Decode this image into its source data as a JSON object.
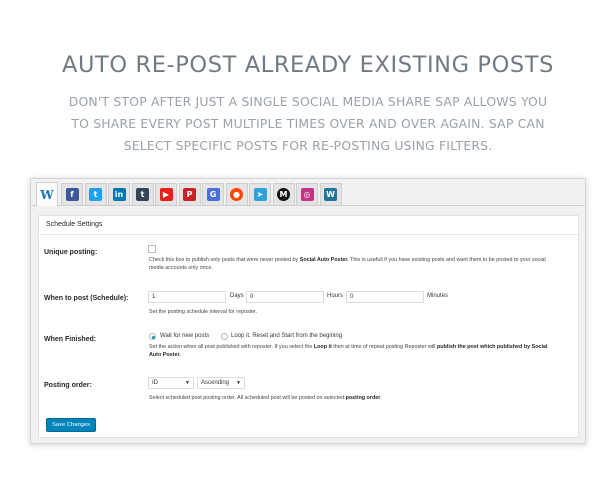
{
  "hero": {
    "title": "AUTO RE-POST ALREADY EXISTING POSTS",
    "line1": "DON'T STOP AFTER JUST A SINGLE SOCIAL MEDIA SHARE SAP ALLOWS YOU",
    "line2": "TO SHARE EVERY POST MULTIPLE TIMES OVER AND OVER AGAIN. SAP CAN",
    "line3": "SELECT SPECIFIC POSTS FOR RE-POSTING USING FILTERS."
  },
  "tabs": {
    "active_logo": "W",
    "items": [
      {
        "icon": "general-w-icon",
        "glyph": "W",
        "color": "#1a74b0"
      },
      {
        "icon": "facebook-icon",
        "glyph": "f",
        "color": "#3b5998"
      },
      {
        "icon": "twitter-icon",
        "glyph": "t",
        "color": "#1da1f2"
      },
      {
        "icon": "linkedin-icon",
        "glyph": "in",
        "color": "#0077b5"
      },
      {
        "icon": "tumblr-icon",
        "glyph": "t",
        "color": "#35465c"
      },
      {
        "icon": "youtube-icon",
        "glyph": "▶",
        "color": "#e62117"
      },
      {
        "icon": "pinterest-icon",
        "glyph": "P",
        "color": "#cb2027"
      },
      {
        "icon": "gmb-icon",
        "glyph": "G",
        "color": "#4a6fd8"
      },
      {
        "icon": "reddit-icon",
        "glyph": "●",
        "color": "#ff4500"
      },
      {
        "icon": "telegram-icon",
        "glyph": "➤",
        "color": "#2aa3d6"
      },
      {
        "icon": "medium-icon",
        "glyph": "M",
        "color": "#111111"
      },
      {
        "icon": "instagram-icon",
        "glyph": "◎",
        "color": "#c13584"
      },
      {
        "icon": "wordpress-icon",
        "glyph": "W",
        "color": "#21759b"
      }
    ]
  },
  "schedule": {
    "title": "Schedule Settings",
    "unique": {
      "label": "Unique posting:",
      "desc_pre": "Check this box to publish only posts that were never posted by ",
      "desc_bold": "Social Auto Poster.",
      "desc_post": " This is usefull if you have existing posts and want them to be posted to your social",
      "desc_line2": "media accounts only once."
    },
    "when": {
      "label": "When to post (Schedule):",
      "days_value": "1",
      "days_unit": "Days",
      "hours_value": "0",
      "hours_unit": "Hours",
      "minutes_value": "0",
      "minutes_unit": "Minutes",
      "desc": "Set the posting schedule interval for reposter."
    },
    "finished": {
      "label": "When Finished:",
      "option1": "Wait for new posts",
      "option2": "Loop it. Reset and Start from the begining",
      "desc_pre": "Set the action when all post published with reposter. If you select the ",
      "desc_bold1": "Loop it",
      "desc_mid": " then at time of repeat posting Reposter will ",
      "desc_bold2": "publish the post which published by Social",
      "desc_line2_bold": "Auto Poster."
    },
    "order": {
      "label": "Posting order:",
      "by_value": "ID",
      "dir_value": "Ascending",
      "desc_pre": "Select scheduled post posting order. All scheduled post will be posted on selected ",
      "desc_bold": "posting order",
      "desc_post": "."
    },
    "save_label": "Save Changes"
  }
}
